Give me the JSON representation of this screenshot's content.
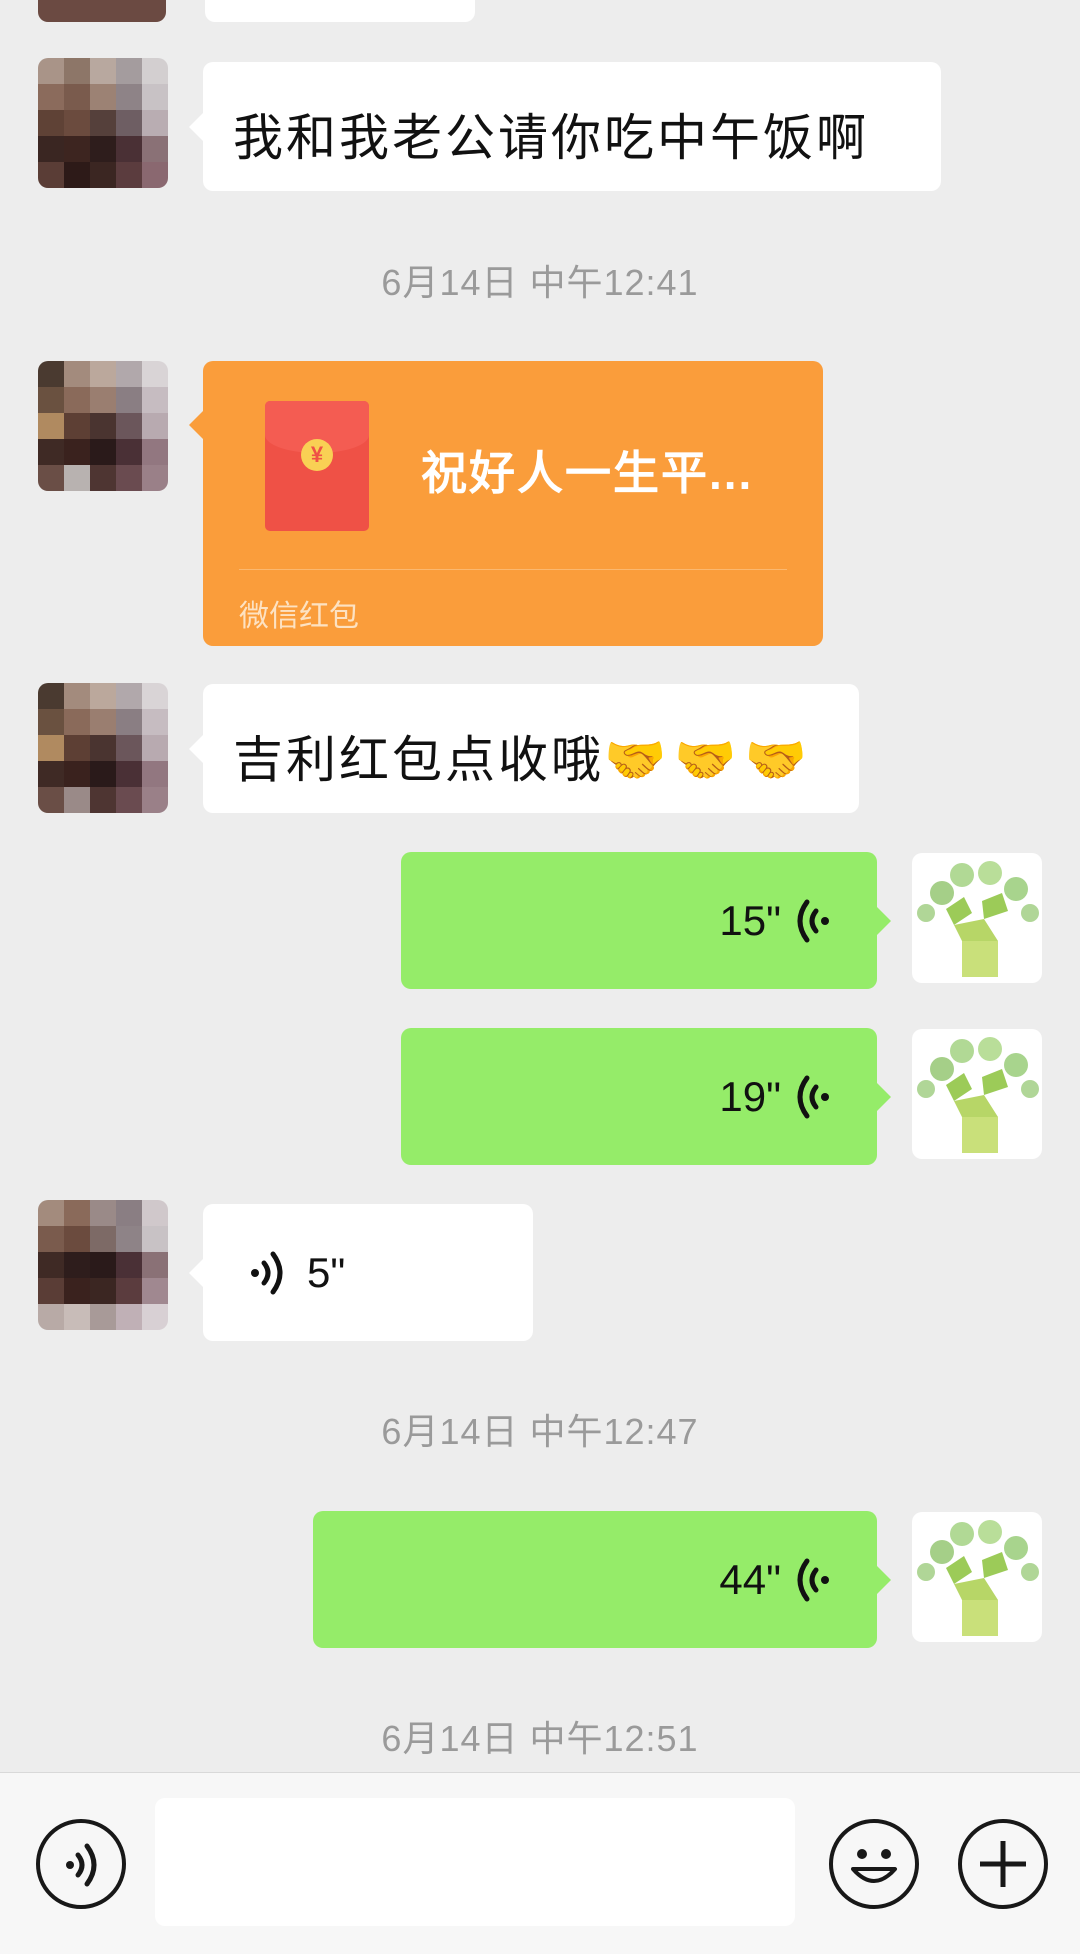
{
  "messages": {
    "m1": {
      "text": "我和我老公请你吃中午饭啊"
    },
    "ts1": "6月14日 中午12:41",
    "red_packet": {
      "greeting": "祝好人一生平...",
      "footer": "微信红包",
      "coin_symbol": "¥"
    },
    "m2": {
      "text": "吉利红包点收哦",
      "emoji": "🤝🤝🤝"
    },
    "v1": {
      "duration": "15\""
    },
    "v2": {
      "duration": "19\""
    },
    "v3": {
      "duration": "5\""
    },
    "ts2": "6月14日 中午12:47",
    "v4": {
      "duration": "44\""
    },
    "ts3": "6月14日 中午12:51"
  },
  "input_bar": {
    "voice_icon": "voice-toggle-icon",
    "emoji_icon": "smiley-icon",
    "plus_icon": "plus-icon",
    "text_value": ""
  },
  "colors": {
    "background": "#ededed",
    "sent_bubble": "#95ec69",
    "received_bubble": "#ffffff",
    "red_packet": "#fa9d3b",
    "timestamp": "#9a9a9a"
  }
}
